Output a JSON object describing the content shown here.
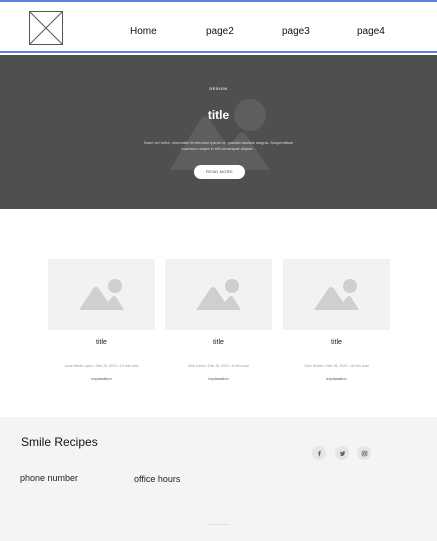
{
  "header": {
    "nav": [
      "Home",
      "page2",
      "page3",
      "page4"
    ]
  },
  "hero": {
    "category": "DESIGN",
    "title": "title",
    "description": "Nunc vel tortor, venenatis fermentum ipsum id, gravida facilisis magna. Suspendisse maximus neque in elit consequat aliquet...",
    "button": "READ MORE"
  },
  "cards": [
    {
      "title": "title",
      "meta": "Anna Maria Lopez • Mar 26, 2022 • 10 min read",
      "excerpt": "explanation"
    },
    {
      "title": "title",
      "meta": "Bob Jones • Feb 18, 2022 • 8 min read",
      "excerpt": "explanation"
    },
    {
      "title": "title",
      "meta": "John Hunter • Mar 06, 2022 • 18 min read",
      "excerpt": "explanation"
    }
  ],
  "footer": {
    "brand": "Smile Recipes",
    "phone_label": "phone number",
    "hours_label": "office hours",
    "social": [
      "facebook-icon",
      "twitter-icon",
      "instagram-icon"
    ]
  },
  "colors": {
    "header_border": "#5b7ee5",
    "hero_bg": "#4f4f4f",
    "footer_bg": "#f4f4f4",
    "placeholder_bg": "#f2f2f2"
  }
}
